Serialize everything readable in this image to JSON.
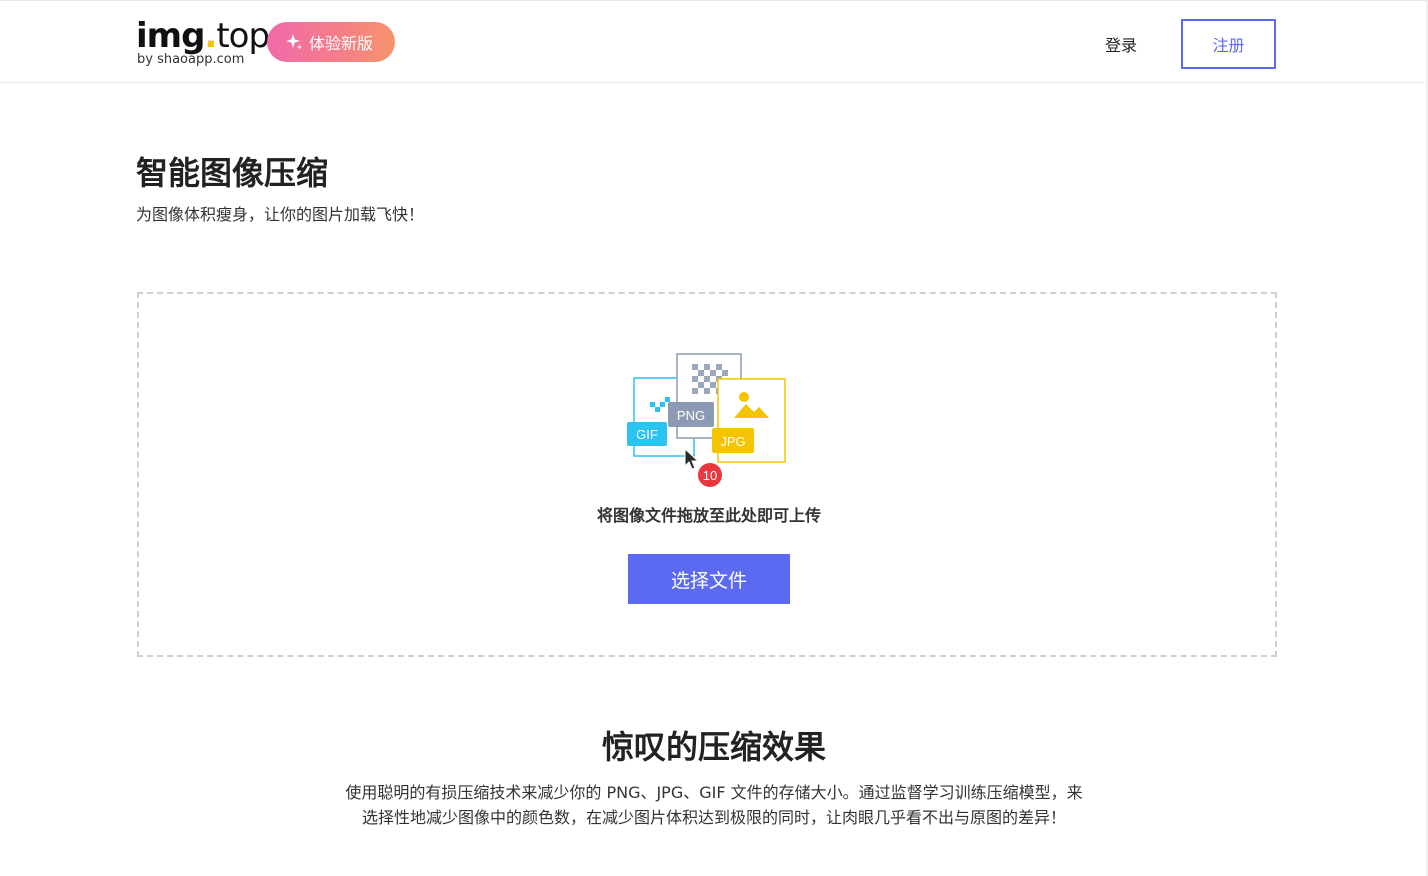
{
  "header": {
    "logo": {
      "main_img": "img",
      "main_dot": ".",
      "main_top": "top",
      "sub": "by shaoapp.com"
    },
    "new_version_label": "体验新版",
    "login_label": "登录",
    "register_label": "注册"
  },
  "hero": {
    "title": "智能图像压缩",
    "subtitle": "为图像体积瘦身，让你的图片加载飞快！"
  },
  "upload": {
    "file_types": [
      "GIF",
      "PNG",
      "JPG"
    ],
    "badge_count": "10",
    "drop_text": "将图像文件拖放至此处即可上传",
    "choose_label": "选择文件"
  },
  "features": {
    "title": "惊叹的压缩效果",
    "desc_line1": "使用聪明的有损压缩技术来减少你的 PNG、JPG、GIF 文件的存储大小。通过监督学习训练压缩模型，来",
    "desc_line2": "选择性地减少图像中的颜色数，在减少图片体积达到极限的同时，让肉眼几乎看不出与原图的差异！"
  },
  "colors": {
    "accent": "#5b6af0",
    "gif": "#29c4f0",
    "png": "#8c9bb3",
    "jpg": "#f5c400",
    "badge": "#e8383d"
  },
  "icons": [
    "sparkle-icon",
    "cursor-icon",
    "image-icon"
  ]
}
